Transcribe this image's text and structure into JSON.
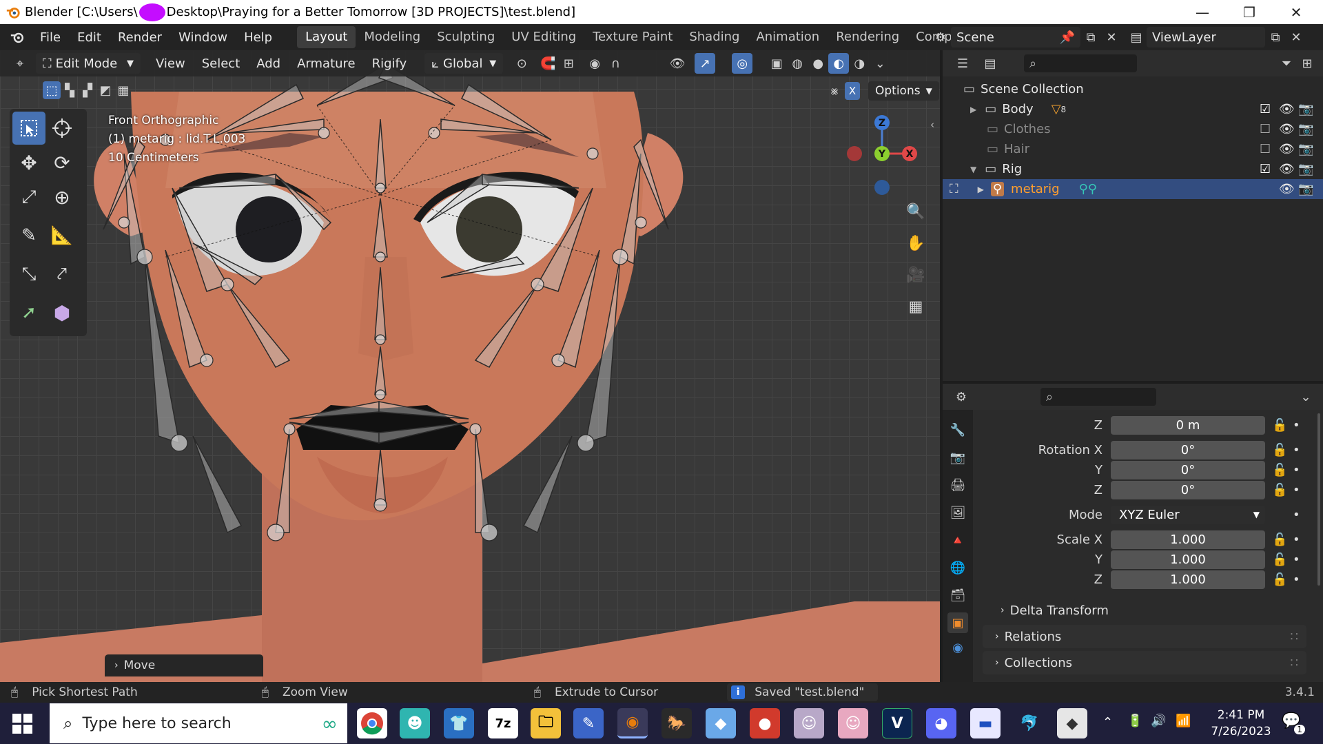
{
  "window": {
    "title_prefix": "Blender [C:\\Users\\",
    "title_suffix": "Desktop\\Praying for a Better Tomorrow [3D PROJECTS]\\test.blend]",
    "minimize": "—",
    "restore": "❐",
    "close": "✕"
  },
  "menus": [
    "File",
    "Edit",
    "Render",
    "Window",
    "Help"
  ],
  "workspaces": [
    "Layout",
    "Modeling",
    "Sculpting",
    "UV Editing",
    "Texture Paint",
    "Shading",
    "Animation",
    "Rendering",
    "Compositing"
  ],
  "active_workspace": "Layout",
  "scene": {
    "name": "Scene",
    "viewlayer": "ViewLayer"
  },
  "viewport_header": {
    "mode": "Edit Mode",
    "menus": [
      "View",
      "Select",
      "Add",
      "Armature",
      "Rigify"
    ],
    "orientation": "Global",
    "options_label": "Options",
    "xray_label": "X"
  },
  "viewport": {
    "view_name": "Front Orthographic",
    "active_object": "(1) metarig : lid.T.L.003",
    "scale": "10 Centimeters",
    "gizmo": {
      "z": "Z",
      "y": "Y",
      "x": "X"
    },
    "last_operator": "Move"
  },
  "outliner": {
    "root": "Scene Collection",
    "items": [
      {
        "name": "Body",
        "badge": "8"
      },
      {
        "name": "Clothes"
      },
      {
        "name": "Hair"
      },
      {
        "name": "Rig"
      },
      {
        "name": "metarig"
      }
    ]
  },
  "properties": {
    "location_z_label": "Z",
    "location_z": "0 m",
    "rotation_x_label": "Rotation X",
    "rotation_x": "0°",
    "rotation_y_label": "Y",
    "rotation_y": "0°",
    "rotation_z_label": "Z",
    "rotation_z": "0°",
    "mode_label": "Mode",
    "mode": "XYZ Euler",
    "scale_x_label": "Scale X",
    "scale_x": "1.000",
    "scale_y_label": "Y",
    "scale_y": "1.000",
    "scale_z_label": "Z",
    "scale_z": "1.000",
    "panels": [
      "Delta Transform",
      "Relations",
      "Collections"
    ]
  },
  "statusbar": {
    "left": "Pick Shortest Path",
    "middle": "Zoom View",
    "right": "Extrude to Cursor",
    "message": "Saved \"test.blend\"",
    "version": "3.4.1"
  },
  "taskbar": {
    "search_placeholder": "Type here to search",
    "time": "2:41 PM",
    "date": "7/26/2023",
    "notification_count": "1",
    "v_label": "V",
    "zip_label": "7z"
  },
  "colors": {
    "accent": "#4772b3",
    "skin": "#c9785a",
    "outliner_selection": "#334d80",
    "bone_active": "#ff9f2e"
  }
}
